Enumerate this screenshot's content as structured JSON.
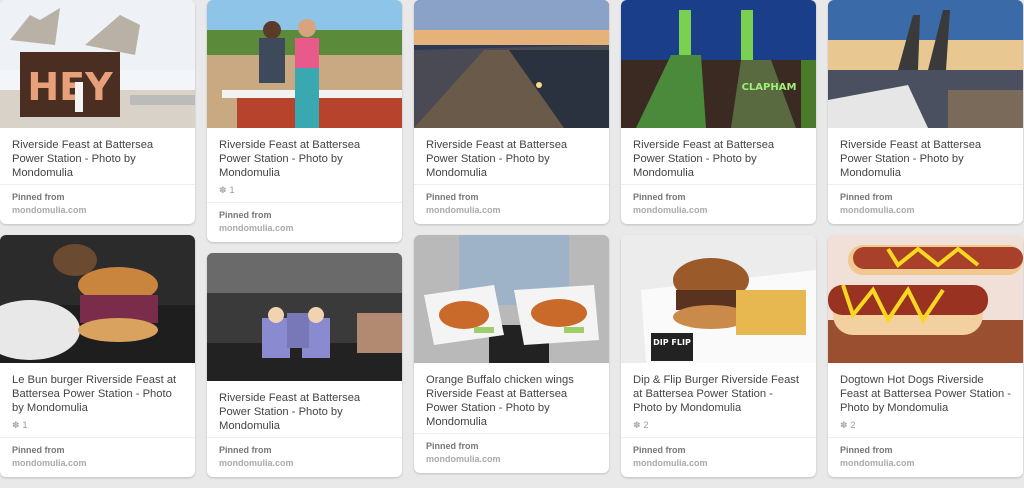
{
  "pinned_from_label": "Pinned from",
  "source": "mondomulia.com",
  "columns": [
    [
      {
        "desc": "Riverside Feast at Battersea Power Station - Photo by Mondomulia",
        "repins": "",
        "img": "hey"
      },
      {
        "desc": "Le Bun burger Riverside Feast at Battersea Power Station - Photo by Mondomulia",
        "repins": "1",
        "img": "burger1"
      }
    ],
    [
      {
        "desc": "Riverside Feast at Battersea Power Station - Photo by Mondomulia",
        "repins": "1",
        "img": "couple"
      },
      {
        "desc": "Riverside Feast at Battersea Power Station - Photo by Mondomulia",
        "repins": "",
        "img": "icecream"
      }
    ],
    [
      {
        "desc": "Riverside Feast at Battersea Power Station - Photo by Mondomulia",
        "repins": "",
        "img": "walkway"
      },
      {
        "desc": "Orange Buffalo chicken wings Riverside Feast at Battersea Power Station - Photo by Mondomulia",
        "repins": "",
        "img": "wings"
      }
    ],
    [
      {
        "desc": "Riverside Feast at Battersea Power Station - Photo by Mondomulia",
        "repins": "",
        "img": "chimneys"
      },
      {
        "desc": "Dip & Flip Burger Riverside Feast at Battersea Power Station - Photo by Mondomulia",
        "repins": "2",
        "img": "dipflip"
      }
    ],
    [
      {
        "desc": "Riverside Feast at Battersea Power Station - Photo by Mondomulia",
        "repins": "",
        "img": "cranes"
      },
      {
        "desc": "Dogtown Hot Dogs Riverside Feast at Battersea Power Station - Photo by Mondomulia",
        "repins": "2",
        "img": "hotdogs"
      }
    ]
  ],
  "image_text": {
    "hey": "HEY",
    "clapham": "CLAPHAM",
    "dipflip": "DIP FLIP"
  }
}
